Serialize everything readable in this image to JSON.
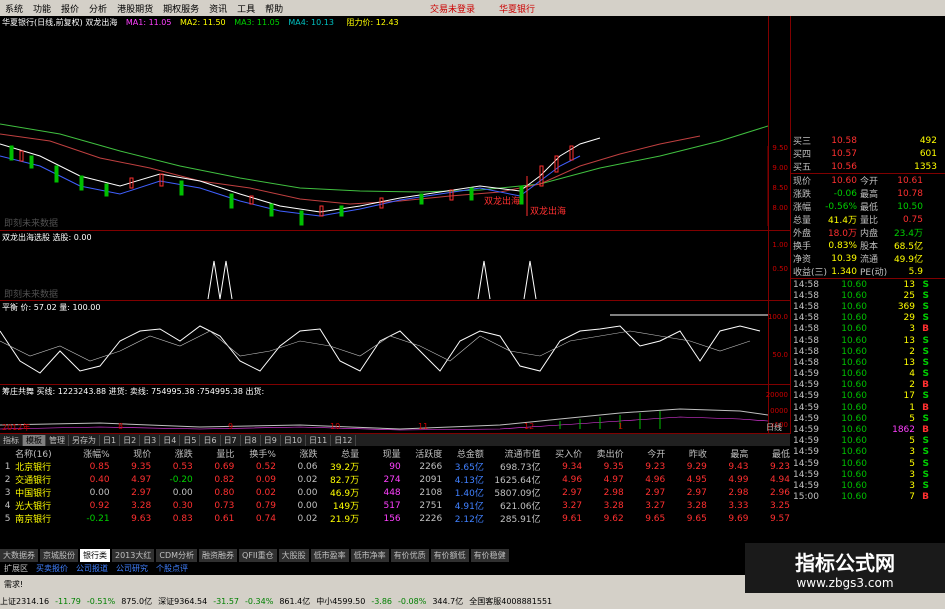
{
  "menu": {
    "items": [
      "系统",
      "功能",
      "报价",
      "分析",
      "港股期货",
      "期权服务",
      "资讯",
      "工具",
      "帮助"
    ],
    "login": "交易未登录",
    "bank": "华夏银行"
  },
  "main_chart": {
    "title": "华夏银行(日线,前复权) 双龙出海",
    "ma1": "MA1: 11.05",
    "ma2": "MA2: 11.50",
    "ma3": "MA3: 11.05",
    "ma4": "MA4: 10.13",
    "resist": "阻力价: 12.43",
    "y_ticks": [
      "9.50",
      "9.00",
      "8.50",
      "8.00"
    ],
    "labels": [
      "双龙出海",
      "双龙出海"
    ],
    "watermark_note": "即刻未来数据"
  },
  "panel2": {
    "title": "双龙出海选股 选股: 0.00",
    "y_ticks": [
      "1.00",
      "0.50"
    ],
    "note": "即刻未来数据"
  },
  "panel3": {
    "title": "平衡 价: 57.02  量: 100.00",
    "y_ticks": [
      "100.0",
      "50.0"
    ]
  },
  "panel4": {
    "title": "筹庄共舞 买线: 1223243.88  进货: 卖线: 754995.38  :754995.38  出货:",
    "y_ticks": [
      "20000",
      "0000",
      "x100"
    ]
  },
  "x_axis": [
    "2012年",
    "8",
    "9",
    "10",
    "11",
    "12",
    "1"
  ],
  "x_axis_right": "日线",
  "quote": {
    "book": [
      {
        "label": "买三",
        "price": "10.58",
        "vol": "492"
      },
      {
        "label": "买四",
        "price": "10.57",
        "vol": "601"
      },
      {
        "label": "买五",
        "price": "10.56",
        "vol": "1353"
      }
    ],
    "stats": [
      {
        "l1": "现价",
        "v1": "10.60",
        "l2": "今开",
        "v2": "10.61"
      },
      {
        "l1": "涨跌",
        "v1": "-0.06",
        "l2": "最高",
        "v2": "10.78"
      },
      {
        "l1": "涨幅",
        "v1": "-0.56%",
        "l2": "最低",
        "v2": "10.50"
      },
      {
        "l1": "总量",
        "v1": "41.4万",
        "l2": "量比",
        "v2": "0.75"
      },
      {
        "l1": "外盘",
        "v1": "18.0万",
        "l2": "内盘",
        "v2": "23.4万"
      },
      {
        "l1": "换手",
        "v1": "0.83%",
        "l2": "股本",
        "v2": "68.5亿"
      },
      {
        "l1": "净资",
        "v1": "10.39",
        "l2": "流通",
        "v2": "49.9亿"
      },
      {
        "l1": "收益(三)",
        "v1": "1.340",
        "l2": "PE(动)",
        "v2": "5.9"
      }
    ],
    "ticks": [
      {
        "t": "14:58",
        "p": "10.60",
        "v": "13",
        "d": "S"
      },
      {
        "t": "14:58",
        "p": "10.60",
        "v": "25",
        "d": "S"
      },
      {
        "t": "14:58",
        "p": "10.60",
        "v": "369",
        "d": "S"
      },
      {
        "t": "14:58",
        "p": "10.60",
        "v": "29",
        "d": "S"
      },
      {
        "t": "14:58",
        "p": "10.60",
        "v": "3",
        "d": "B"
      },
      {
        "t": "14:58",
        "p": "10.60",
        "v": "13",
        "d": "S"
      },
      {
        "t": "14:58",
        "p": "10.60",
        "v": "2",
        "d": "S"
      },
      {
        "t": "14:58",
        "p": "10.60",
        "v": "13",
        "d": "S"
      },
      {
        "t": "14:59",
        "p": "10.60",
        "v": "4",
        "d": "S"
      },
      {
        "t": "14:59",
        "p": "10.60",
        "v": "2",
        "d": "B"
      },
      {
        "t": "14:59",
        "p": "10.60",
        "v": "17",
        "d": "S"
      },
      {
        "t": "14:59",
        "p": "10.60",
        "v": "1",
        "d": "B"
      },
      {
        "t": "14:59",
        "p": "10.60",
        "v": "5",
        "d": "S"
      },
      {
        "t": "14:59",
        "p": "10.60",
        "v": "1862",
        "d": "B"
      },
      {
        "t": "14:59",
        "p": "10.60",
        "v": "5",
        "d": "S"
      },
      {
        "t": "14:59",
        "p": "10.60",
        "v": "3",
        "d": "S"
      },
      {
        "t": "14:59",
        "p": "10.60",
        "v": "5",
        "d": "S"
      },
      {
        "t": "14:59",
        "p": "10.60",
        "v": "3",
        "d": "S"
      },
      {
        "t": "14:59",
        "p": "10.60",
        "v": "3",
        "d": "S"
      },
      {
        "t": "15:00",
        "p": "10.60",
        "v": "7",
        "d": "B"
      }
    ]
  },
  "tabs": [
    "指标",
    "模板",
    "管理",
    "另存为",
    "日1",
    "日2",
    "日3",
    "日4",
    "日5",
    "日6",
    "日7",
    "日8",
    "日9",
    "日10",
    "日11",
    "日12"
  ],
  "table": {
    "headers": [
      "名称(16)",
      "涨幅%",
      "现价",
      "涨跌",
      "量比",
      "换手%",
      "涨跌",
      "总量",
      "现量",
      "活跃度",
      "总金额",
      "流通市值",
      "买入价",
      "卖出价",
      "今开",
      "昨收",
      "最高",
      "最低"
    ],
    "rows": [
      {
        "idx": "1",
        "name": "北京银行",
        "cells": [
          "0.85",
          "9.35",
          "0.53",
          "0.69",
          "0.52",
          "0.06",
          "39.2万",
          "90",
          "2266",
          "3.65亿",
          "698.73亿",
          "9.34",
          "9.35",
          "9.23",
          "9.29",
          "9.43",
          "9.23"
        ]
      },
      {
        "idx": "2",
        "name": "交通银行",
        "cells": [
          "0.40",
          "4.97",
          "-0.20",
          "0.82",
          "0.09",
          "0.02",
          "82.7万",
          "274",
          "2091",
          "4.13亿",
          "1625.64亿",
          "4.96",
          "4.97",
          "4.96",
          "4.95",
          "4.99",
          "4.94"
        ]
      },
      {
        "idx": "3",
        "name": "中国银行",
        "cells": [
          "0.00",
          "2.97",
          "0.00",
          "0.80",
          "0.02",
          "0.00",
          "46.9万",
          "448",
          "2108",
          "1.40亿",
          "5807.09亿",
          "2.97",
          "2.98",
          "2.97",
          "2.97",
          "2.98",
          "2.96"
        ]
      },
      {
        "idx": "4",
        "name": "光大银行",
        "cells": [
          "0.92",
          "3.28",
          "0.30",
          "0.73",
          "0.79",
          "0.00",
          "149万",
          "517",
          "2751",
          "4.91亿",
          "621.06亿",
          "3.27",
          "3.28",
          "3.27",
          "3.28",
          "3.33",
          "3.25"
        ]
      },
      {
        "idx": "5",
        "name": "南京银行",
        "cells": [
          "-0.21",
          "9.63",
          "0.83",
          "0.61",
          "0.74",
          "0.02",
          "21.9万",
          "156",
          "2226",
          "2.12亿",
          "285.91亿",
          "9.61",
          "9.62",
          "9.65",
          "9.65",
          "9.69",
          "9.57"
        ]
      }
    ]
  },
  "sectors": [
    "大数据券",
    "京城股份",
    "银行类",
    "2013大红",
    "CDM分析",
    "融资融券",
    "QFII重仓",
    "大股股",
    "低市盈率",
    "低市净率",
    "有价优质",
    "有价额低",
    "有价稳健"
  ],
  "ext": [
    "扩展区",
    "买卖报价",
    "公司报道",
    "公司研究",
    "个股点评"
  ],
  "panel_label": "需求!",
  "status": [
    {
      "t": "上证2314.16",
      "c": ""
    },
    {
      "t": "-11.79",
      "c": "g"
    },
    {
      "t": "-0.51%",
      "c": "g"
    },
    {
      "t": "875.0亿",
      "c": ""
    },
    {
      "t": "深证9364.54",
      "c": ""
    },
    {
      "t": "-31.57",
      "c": "g"
    },
    {
      "t": "-0.34%",
      "c": "g"
    },
    {
      "t": "861.4亿",
      "c": ""
    },
    {
      "t": "中小4599.50",
      "c": ""
    },
    {
      "t": "-3.86",
      "c": "g"
    },
    {
      "t": "-0.08%",
      "c": "g"
    },
    {
      "t": "344.7亿",
      "c": ""
    },
    {
      "t": "全国客服4008881551",
      "c": ""
    }
  ],
  "watermark": {
    "line1": "指标公式网",
    "line2": "www.zbgs3.com"
  },
  "colors": {
    "up": "#ff3030",
    "down": "#00d000",
    "border": "#800000",
    "ma_green": "#40c040"
  }
}
